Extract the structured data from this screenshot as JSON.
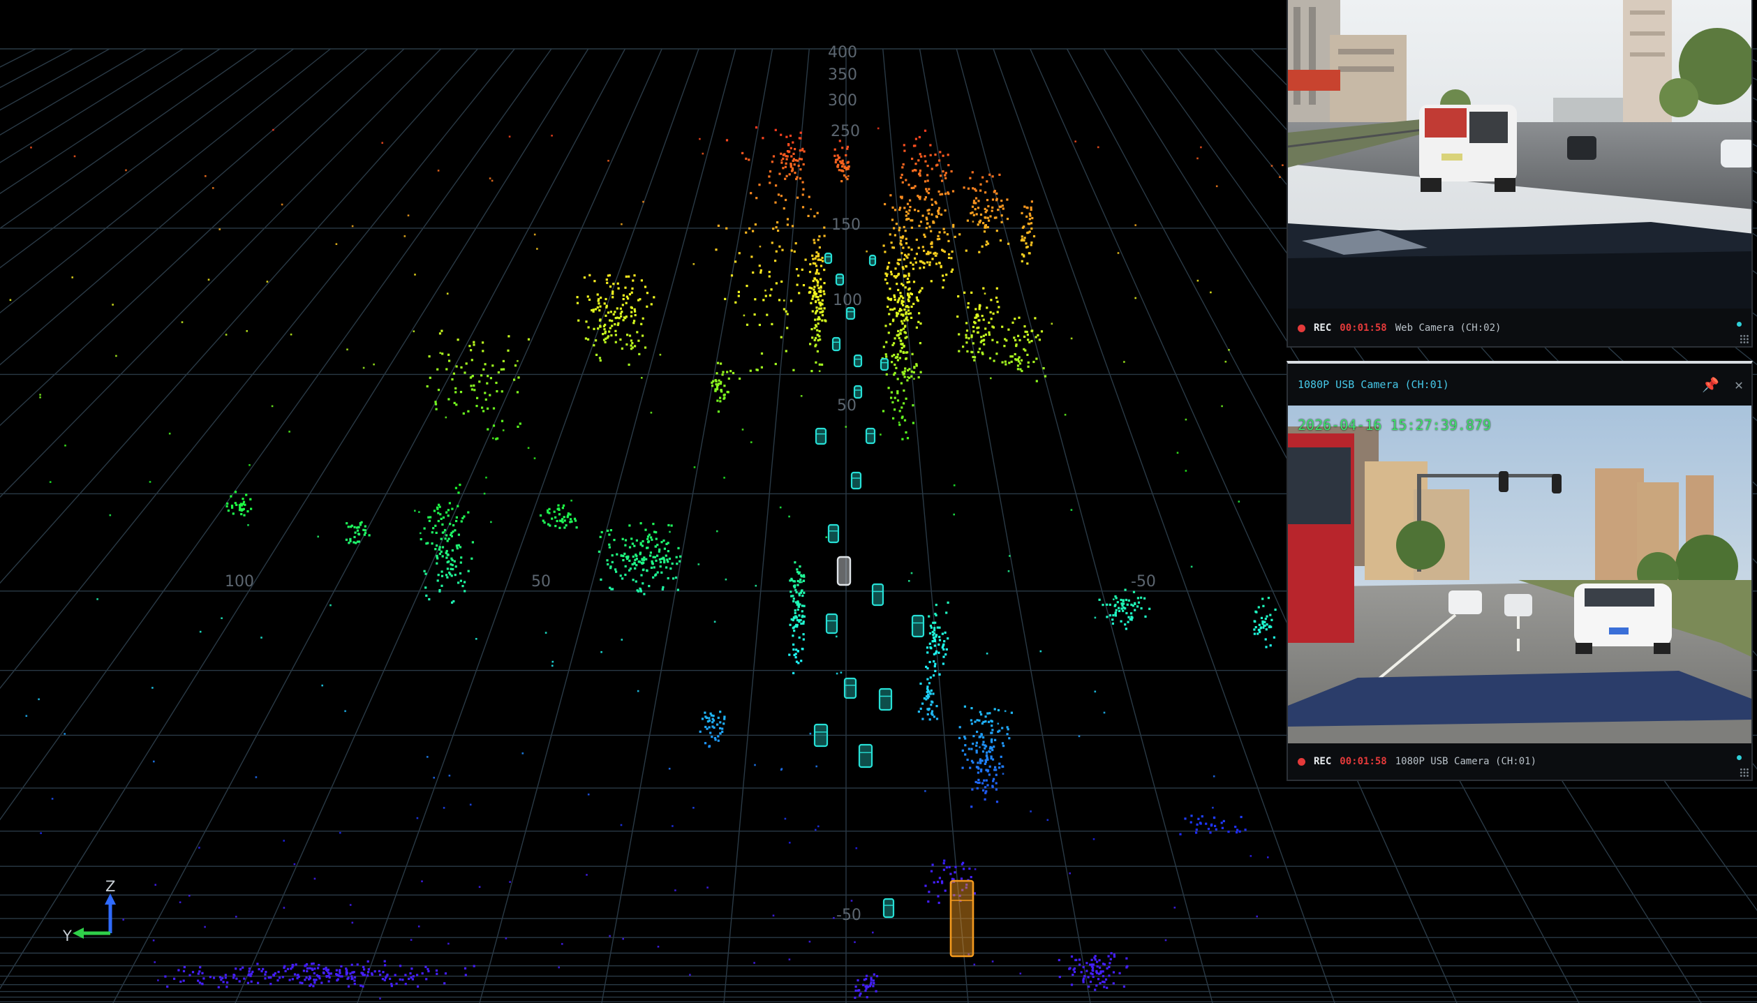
{
  "viewer": {
    "grid_labels_vertical": [
      "400",
      "350",
      "300",
      "250",
      "150",
      "100",
      "50",
      "-50"
    ],
    "grid_labels_horizontal": [
      "100",
      "50",
      "-50"
    ],
    "axis_gizmo": {
      "z_label": "Z",
      "y_label": "Y"
    },
    "colors": {
      "background": "#000000",
      "grid": "#2a3a46",
      "box_car": "#27e0d6",
      "box_truck": "#f39a1e",
      "ego": "#dfe4e8"
    }
  },
  "cam_ch02": {
    "rec_label": "REC",
    "rec_time": "00:01:58",
    "name": "Web  Camera (CH:02)"
  },
  "cam_ch01": {
    "title": "1080P USB Camera (CH:01)",
    "timestamp": "2026-04-16 15:27:39.879",
    "rec_label": "REC",
    "rec_time": "00:01:58",
    "name": "1080P USB Camera (CH:01)",
    "pin_icon": "pin-icon",
    "close_icon": "close-icon"
  }
}
